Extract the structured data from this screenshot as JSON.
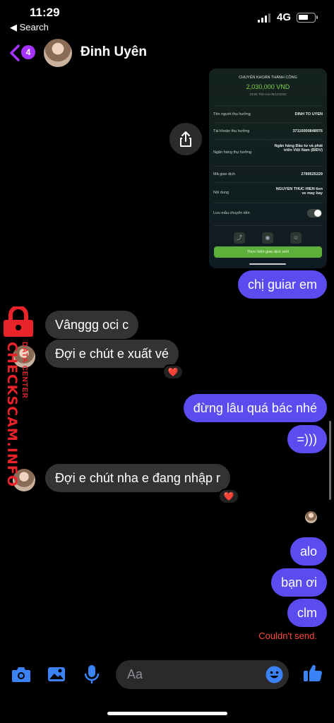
{
  "status_bar": {
    "time": "11:29",
    "back_app": "◀ Search",
    "network": "4G"
  },
  "header": {
    "unread_count": "4",
    "contact_name": "Đinh Uyên"
  },
  "receipt": {
    "title": "CHUYỂN KHOẢN THÀNH CÔNG",
    "amount": "2,030,000 VND",
    "datetime": "10:55 Thứ Hai 05/12/2022",
    "rows": [
      {
        "label": "Tên người thụ hưởng",
        "value": "DINH TO UYEN"
      },
      {
        "label": "Tài khoản thụ hưởng",
        "value": "37110000848976"
      },
      {
        "label": "Ngân hàng thụ hưởng",
        "value": "Ngân hàng Đầu tư và phát triển Việt Nam (BIDV)"
      },
      {
        "label": "Mã giao dịch",
        "value": "2789525229"
      },
      {
        "label": "Nội dung",
        "value": "NGUYEN THUC HIEN tien ve may bay"
      }
    ],
    "save_template_label": "Lưu mẫu chuyển tiền",
    "new_transaction_button": "Thực hiện giao dịch mới"
  },
  "messages": [
    {
      "direction": "out",
      "text": "chị guiar em"
    },
    {
      "direction": "in",
      "text": "Vânggg oci c"
    },
    {
      "direction": "in",
      "text": "Đợi e chút e xuất vé",
      "reaction": "❤️"
    },
    {
      "direction": "out",
      "text": "đừng lâu quá bác nhé"
    },
    {
      "direction": "out",
      "text": "=)))"
    },
    {
      "direction": "in",
      "text": "Đợi e chút nha e đang nhập r",
      "reaction": "❤️"
    },
    {
      "direction": "out",
      "text": "alo"
    },
    {
      "direction": "out",
      "text": "bạn ơi"
    },
    {
      "direction": "out",
      "text": "clm"
    }
  ],
  "send_error": "Couldn't send.",
  "watermark": {
    "main": "CHECKSCAM.INFO",
    "sub": "DATA CENTER"
  },
  "composer": {
    "placeholder": "Aa"
  },
  "colors": {
    "outgoing_bubble": "#5b4cf0",
    "incoming_bubble": "#333335",
    "accent_icons": "#3b82f6",
    "error": "#ff4a3d",
    "watermark": "#e8232a"
  },
  "icons": [
    "back-chevron-icon",
    "share-icon",
    "camera-icon",
    "image-icon",
    "microphone-icon",
    "emoji-icon",
    "thumbs-up-icon",
    "lock-icon"
  ]
}
